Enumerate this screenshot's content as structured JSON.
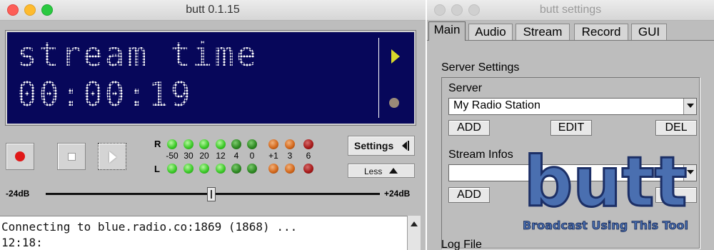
{
  "main_window": {
    "title": "butt 0.1.15",
    "display": {
      "line1": "stream time",
      "line2": "00:00:19"
    },
    "vu": {
      "left_label": "R",
      "right_label": "L",
      "scale": [
        "-50",
        "30",
        "20",
        "12",
        "4",
        "0",
        "+1",
        "3",
        "6"
      ]
    },
    "settings_label": "Settings",
    "less_label": "Less",
    "gain_min": "-24dB",
    "gain_max": "+24dB",
    "gain_value": 0,
    "log_lines": [
      "Connecting to blue.radio.co:1869 (1868) ...",
      "12:18:"
    ]
  },
  "settings_window": {
    "title": "butt settings",
    "tabs": [
      "Main",
      "Audio",
      "Stream",
      "Record",
      "GUI"
    ],
    "active_tab": "Main",
    "server_settings_title": "Server Settings",
    "server_label": "Server",
    "server_selected": "My Radio Station",
    "add_label": "ADD",
    "edit_label": "EDIT",
    "del_label": "DEL",
    "stream_infos_label": "Stream Infos",
    "stream_infos_value": "",
    "log_file_label": "Log File"
  },
  "logo": {
    "wordmark": "butt",
    "tagline": "Broadcast Using This Tool"
  },
  "colors": {
    "display_bg": "#07075a",
    "record": "#e01818",
    "led_green": "#3ecb2a",
    "led_orange": "#d46a1e",
    "led_red": "#a81b1b",
    "logo_blue": "#4a6fb0"
  }
}
